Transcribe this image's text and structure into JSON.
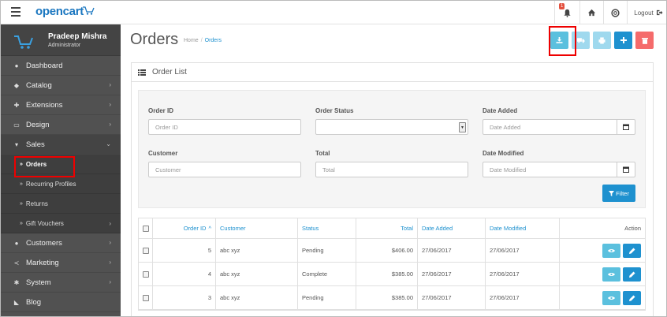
{
  "header": {
    "logo": "opencart",
    "notification_count": "1",
    "logout_label": "Logout"
  },
  "sidebar": {
    "user_name": "Pradeep Mishra",
    "user_role": "Administrator",
    "items": [
      {
        "label": "Dashboard"
      },
      {
        "label": "Catalog"
      },
      {
        "label": "Extensions"
      },
      {
        "label": "Design"
      },
      {
        "label": "Sales"
      }
    ],
    "sales_sub": [
      {
        "label": "Orders"
      },
      {
        "label": "Recurring Profiles"
      },
      {
        "label": "Returns"
      },
      {
        "label": "Gift Vouchers"
      }
    ],
    "items_after": [
      {
        "label": "Customers"
      },
      {
        "label": "Marketing"
      },
      {
        "label": "System"
      },
      {
        "label": "Blog"
      }
    ]
  },
  "page": {
    "title": "Orders",
    "breadcrumb": [
      "Home",
      "Orders"
    ]
  },
  "panel": {
    "title": "Order List"
  },
  "filter": {
    "order_id_label": "Order ID",
    "order_id_placeholder": "Order ID",
    "order_status_label": "Order Status",
    "date_added_label": "Date Added",
    "date_added_placeholder": "Date Added",
    "customer_label": "Customer",
    "customer_placeholder": "Customer",
    "total_label": "Total",
    "total_placeholder": "Total",
    "date_modified_label": "Date Modified",
    "date_modified_placeholder": "Date Modified",
    "button_label": "Filter"
  },
  "table": {
    "columns": {
      "order_id": "Order ID",
      "customer": "Customer",
      "status": "Status",
      "total": "Total",
      "date_added": "Date Added",
      "date_modified": "Date Modified",
      "action": "Action"
    },
    "rows": [
      {
        "order_id": "5",
        "customer": "abc xyz",
        "status": "Pending",
        "total": "$406.00",
        "date_added": "27/06/2017",
        "date_modified": "27/06/2017"
      },
      {
        "order_id": "4",
        "customer": "abc xyz",
        "status": "Complete",
        "total": "$385.00",
        "date_added": "27/06/2017",
        "date_modified": "27/06/2017"
      },
      {
        "order_id": "3",
        "customer": "abc xyz",
        "status": "Pending",
        "total": "$385.00",
        "date_added": "27/06/2017",
        "date_modified": "27/06/2017"
      }
    ]
  },
  "colors": {
    "primary": "#1e91cf",
    "info": "#5bc0de",
    "danger": "#f56b6b",
    "sidebar": "#515151",
    "highlight": "#ee0000"
  }
}
